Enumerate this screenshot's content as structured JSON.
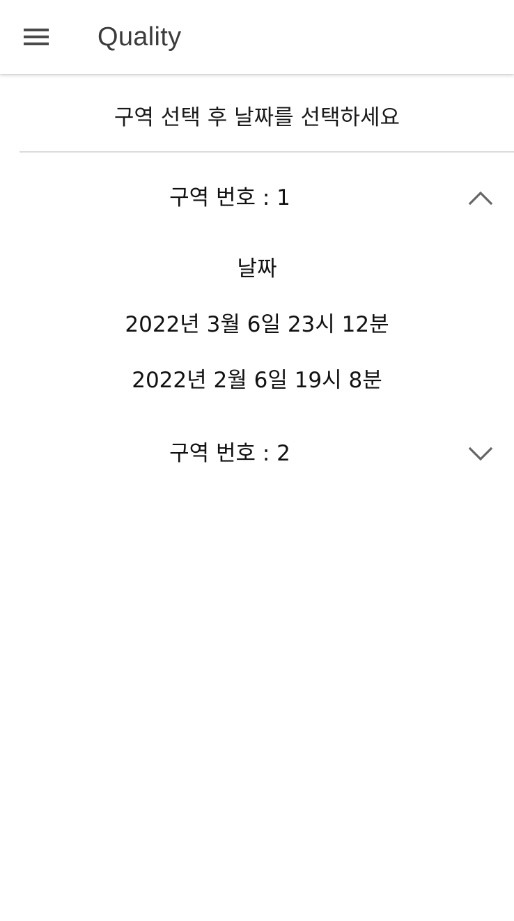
{
  "appbar": {
    "title": "Quality",
    "menu_icon": "hamburger-menu-icon"
  },
  "instruction": "구역 선택 후 날짜를 선택하세요",
  "sections": [
    {
      "label": "구역 번호 : 1",
      "expanded": true,
      "chevron_icon": "chevron-up-icon",
      "dates_header": "날짜",
      "dates": [
        "2022년 3월 6일 23시 12분",
        "2022년 2월 6일 19시 8분"
      ]
    },
    {
      "label": "구역 번호 : 2",
      "expanded": false,
      "chevron_icon": "chevron-down-icon"
    }
  ],
  "colors": {
    "title_text": "#3b3b3b",
    "icon": "#4a4a4a",
    "chevron": "#666666",
    "divider": "#dcdcdc",
    "background": "#ffffff"
  }
}
